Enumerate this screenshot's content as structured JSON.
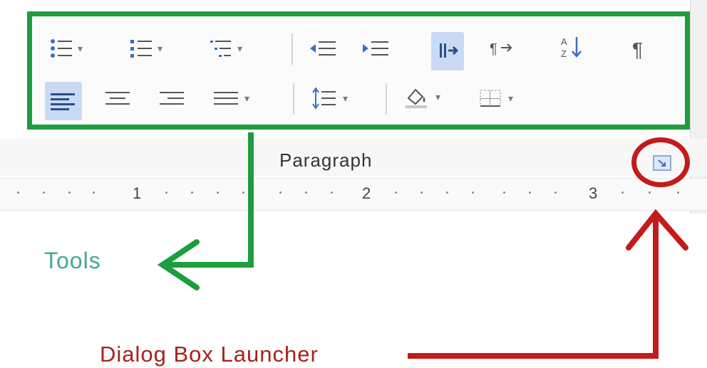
{
  "group": {
    "label": "Paragraph",
    "launcher_icon": "dialog-launcher-icon"
  },
  "toolbar": {
    "row1": [
      {
        "icon": "bullets-icon",
        "dropdown": true
      },
      {
        "icon": "numbering-icon",
        "dropdown": true
      },
      {
        "icon": "multilevel-list-icon",
        "dropdown": true
      },
      {
        "icon": "decrease-indent-icon",
        "dropdown": false
      },
      {
        "icon": "increase-indent-icon",
        "dropdown": false
      },
      {
        "icon": "ltr-text-direction-icon",
        "dropdown": false,
        "active": true
      },
      {
        "icon": "rtl-text-direction-icon",
        "dropdown": false
      },
      {
        "icon": "sort-icon",
        "dropdown": false
      },
      {
        "icon": "show-hide-marks-icon",
        "dropdown": false
      }
    ],
    "row2": [
      {
        "icon": "align-left-icon",
        "dropdown": false,
        "active": true
      },
      {
        "icon": "align-center-icon",
        "dropdown": false
      },
      {
        "icon": "align-right-icon",
        "dropdown": false
      },
      {
        "icon": "justify-icon",
        "dropdown": true
      },
      {
        "icon": "line-spacing-icon",
        "dropdown": true
      },
      {
        "icon": "shading-icon",
        "dropdown": true
      },
      {
        "icon": "borders-icon",
        "dropdown": true
      }
    ]
  },
  "ruler": {
    "numbers": [
      "1",
      "2",
      "3"
    ]
  },
  "annotations": {
    "tools_label": "Tools",
    "launcher_label": "Dialog Box Launcher",
    "tools_color": "#1f9d3e",
    "launcher_color": "#c41a1a"
  }
}
